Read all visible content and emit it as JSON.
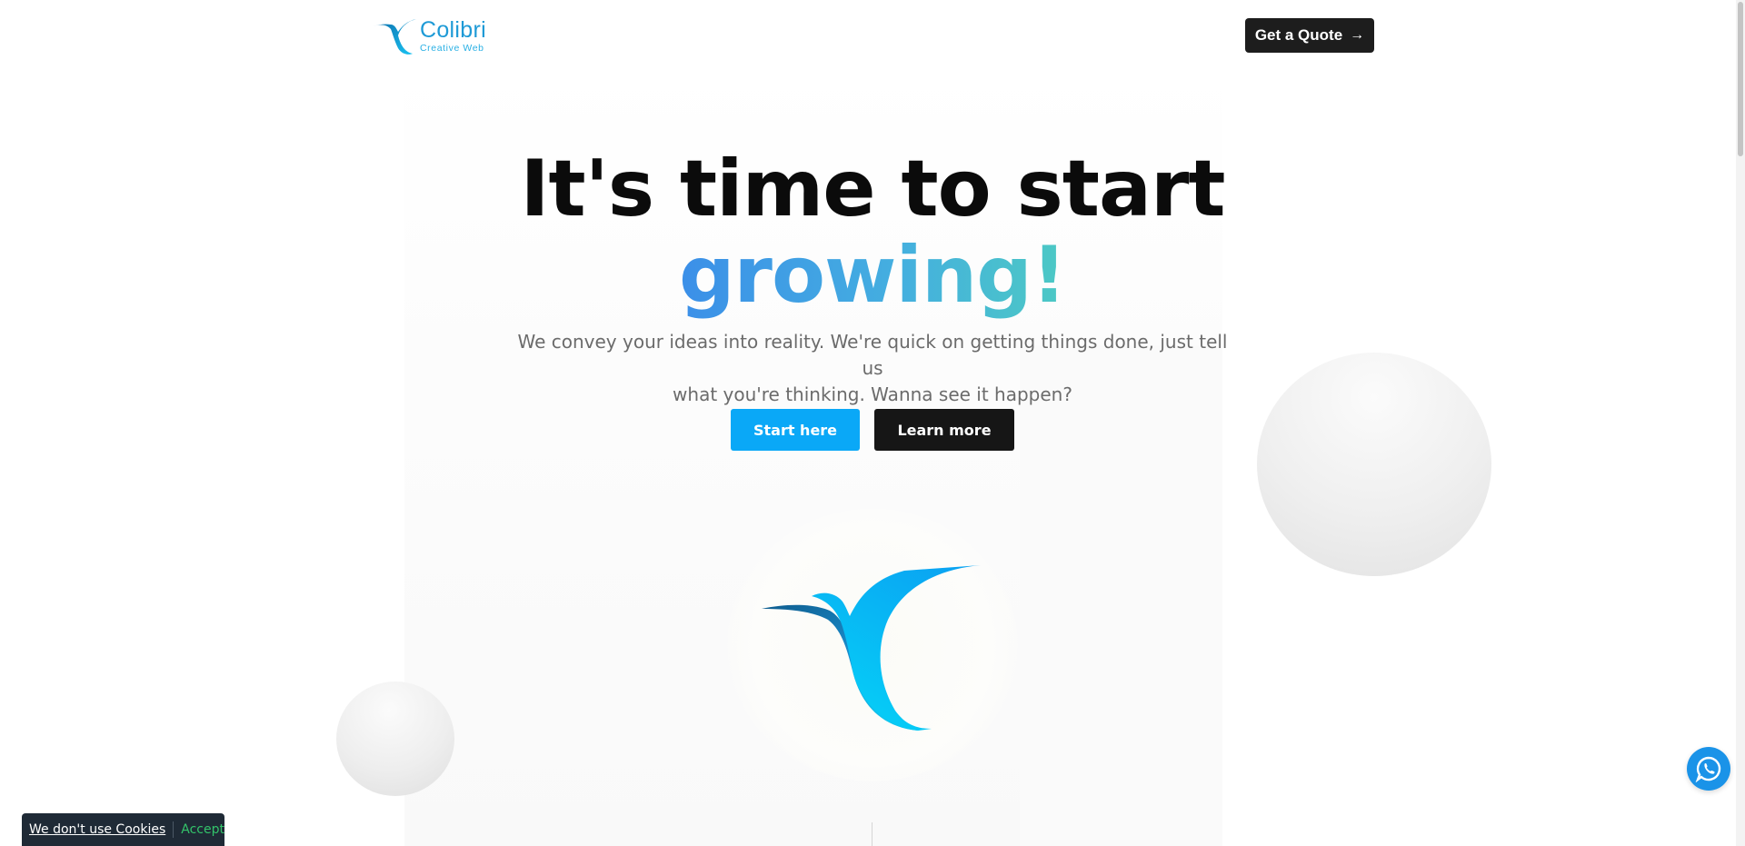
{
  "header": {
    "logo": {
      "name": "Colibri",
      "tagline": "Creative Web"
    },
    "quote_button": {
      "label": "Get a Quote",
      "icon": "arrow-right-icon"
    }
  },
  "hero": {
    "title_line1": "It's time to start",
    "title_line2": "growing!",
    "subtitle_line1": "We convey your ideas into reality. We're quick on getting things done, just tell us",
    "subtitle_line2": "what you're thinking. Wanna see it happen?",
    "primary_button": "Start here",
    "secondary_button": "Learn more",
    "illustration": "hummingbird-logo-icon"
  },
  "floating": {
    "whatsapp_icon": "whatsapp-icon"
  },
  "cookie_bar": {
    "link": "We don't use Cookies",
    "accept": "Accept"
  },
  "colors": {
    "primary_blue": "#0aa8f7",
    "dark": "#161616",
    "gradient_start": "#3b8fe8",
    "gradient_end": "#4cc9c4",
    "whatsapp_blue": "#1a93e8",
    "cookie_bg": "#1f2a36",
    "cookie_accept": "#33c36a"
  }
}
